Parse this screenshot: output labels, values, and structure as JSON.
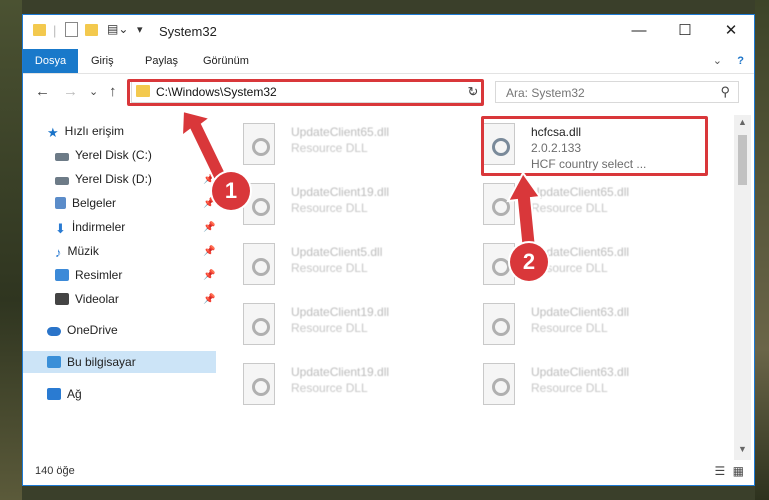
{
  "window": {
    "title": "System32",
    "minimize_glyph": "—",
    "maximize_glyph": "☐",
    "close_glyph": "✕"
  },
  "ribbon": {
    "tabs": [
      "Dosya",
      "Giriş",
      "Paylaş",
      "Görünüm"
    ],
    "expand_glyph": "⌄",
    "help_glyph": "?"
  },
  "navigation": {
    "back_glyph": "←",
    "forward_glyph": "→",
    "recent_glyph": "⌄",
    "up_glyph": "↑",
    "address_path": "C:\\Windows\\System32",
    "address_dropdown_glyph": "⌄",
    "refresh_glyph": "↻",
    "search_placeholder": "Ara: System32",
    "search_glyph": "⚲"
  },
  "sidebar": {
    "items": [
      {
        "label": "Hızlı erişim",
        "icon": "star-icon",
        "color": "#1a73c8"
      },
      {
        "label": "Yerel Disk (C:)",
        "icon": "drive-icon",
        "color": "#6d7b87",
        "pinned": true
      },
      {
        "label": "Yerel Disk (D:)",
        "icon": "drive-icon",
        "color": "#6d7b87",
        "pinned": true
      },
      {
        "label": "Belgeler",
        "icon": "documents-icon",
        "color": "#5b8cc9",
        "pinned": true
      },
      {
        "label": "İndirmeler",
        "icon": "download-icon",
        "color": "#2a7bd2",
        "pinned": true
      },
      {
        "label": "Müzik",
        "icon": "music-icon",
        "color": "#2a7bd2",
        "pinned": true
      },
      {
        "label": "Resimler",
        "icon": "pictures-icon",
        "color": "#3c8ad8",
        "pinned": true
      },
      {
        "label": "Videolar",
        "icon": "videos-icon",
        "color": "#444444",
        "pinned": true
      },
      {
        "label": "OneDrive",
        "icon": "cloud-icon",
        "color": "#2a74c9"
      },
      {
        "label": "Bu bilgisayar",
        "icon": "computer-icon",
        "color": "#3a8fd8",
        "selected": true
      },
      {
        "label": "Ağ",
        "icon": "network-icon",
        "color": "#2a7bd2"
      }
    ],
    "pin_glyph": "📌"
  },
  "files": [
    {
      "name": "UpdateClient65.dll",
      "type": "Resource DLL"
    },
    {
      "name": "hcfcsa.dll",
      "version": "2.0.2.133",
      "description": "HCF country select ..."
    },
    {
      "name": "UpdateClient19.dll",
      "type": "Resource DLL"
    },
    {
      "name": "UpdateClient65.dll",
      "type": "Resource DLL"
    },
    {
      "name": "UpdateClient5.dll",
      "type": "Resource DLL"
    },
    {
      "name": "UpdateClient65.dll",
      "type": "Resource DLL"
    },
    {
      "name": "UpdateClient19.dll",
      "type": "Resource DLL"
    },
    {
      "name": "UpdateClient63.dll",
      "type": "Resource DLL"
    },
    {
      "name": "UpdateClient19.dll",
      "type": "Resource DLL"
    },
    {
      "name": "UpdateClient63.dll",
      "type": "Resource DLL"
    }
  ],
  "status": {
    "item_count": "140 öğe",
    "details_view_glyph": "☰",
    "tiles_view_glyph": "▦"
  },
  "annotations": {
    "step1": "1",
    "step2": "2",
    "color": "#d9373a"
  },
  "scrollbar": {
    "up_glyph": "▲",
    "down_glyph": "▼"
  }
}
